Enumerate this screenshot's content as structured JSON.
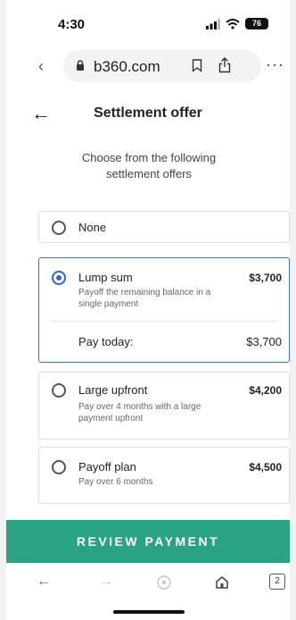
{
  "status_bar": {
    "time": "4:30",
    "battery": "76"
  },
  "browser": {
    "url": "b360.com"
  },
  "header": {
    "title": "Settlement offer"
  },
  "subtitle": "Choose from the following settlement offers",
  "offers": [
    {
      "label": "None",
      "amount": "",
      "description": "",
      "selected": false
    },
    {
      "label": "Lump sum",
      "amount": "$3,700",
      "description": "Payoff the remaining balance in a single payment",
      "selected": true,
      "pay_today_label": "Pay today:",
      "pay_today_value": "$3,700"
    },
    {
      "label": "Large upfront",
      "amount": "$4,200",
      "description": "Pay over 4 months with a large payment upfront",
      "selected": false
    },
    {
      "label": "Payoff plan",
      "amount": "$4,500",
      "description": "Pay over 6 months",
      "selected": false
    }
  ],
  "cta": {
    "label": "REVIEW PAYMENT"
  },
  "bottom_nav": {
    "tabs_count": "2"
  },
  "colors": {
    "accent": "#2aa383",
    "selected_border": "#3b6fd6",
    "radio_selected": "#2f64d6"
  }
}
